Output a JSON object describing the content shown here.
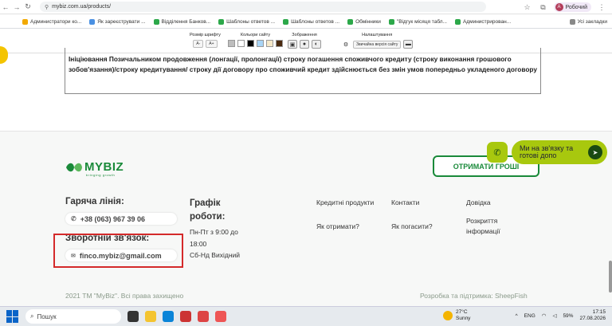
{
  "browser": {
    "url": "mybiz.com.ua/products/",
    "profile_label": "Робочий",
    "profile_initial": "А",
    "bookmarks": [
      "Администратори ко...",
      "Як зареєструвати ...",
      "Відділення Банков...",
      "Шаблоны ответов ...",
      "Шаблоны ответов ...",
      "Обмінники",
      "\"Відгук місяця табл...",
      "Администрирован..."
    ],
    "all_bookmarks": "Усі закладки"
  },
  "a11y": {
    "font_size_title": "Розмір шрифту",
    "font_minus": "A-",
    "font_plus": "A+",
    "colors_title": "Кольори сайту",
    "colors": [
      "#bdbdbd",
      "#ffffff",
      "#000000",
      "#a8d4f5",
      "#f5e8c8",
      "#4a2a10"
    ],
    "images_title": "Зображення",
    "settings_title": "Налаштування",
    "normal_version": "Звичайна версія сайту"
  },
  "content": {
    "text": "Ініціювання Позичальником продовження (лонгації, пролонгації) строку погашення споживчого кредиту (строку виконання грошового зобов'язання)/строку кредитування/ строку дії договору про споживчий кредит здійснюється без змін умов попередньо укладеного договору"
  },
  "footer": {
    "logo_text": "MYBIZ",
    "logo_tagline": "bringing growth",
    "get_money": "ОТРИМАТИ ГРОШІ",
    "hotline_title": "Гаряча лінія:",
    "phone": "+38 (063) 967 39 06",
    "feedback_title": "Зворотній зв'язок:",
    "email": "finco.mybiz@gmail.com",
    "schedule_title": "Графік роботи:",
    "schedule_lines": [
      "Пн-Пт з 9:00 до",
      "18:00",
      "Сб-Нд Вихідний"
    ],
    "links": {
      "credit_products": "Кредитні продукти",
      "contacts": "Контакти",
      "help": "Довідка",
      "how_get": "Як отримати?",
      "how_repay": "Як погасити?",
      "disclosure": "Розкриття інформації"
    },
    "copyright": "2021 ТМ \"MyBiz\". Всі права захищено",
    "developer": "Розробка та підтримка: SheepFish",
    "chat_text": "Ми на зв'язку та готові допо"
  },
  "taskbar": {
    "search_placeholder": "Пошук",
    "temperature": "27°C",
    "weather": "Sunny",
    "language": "ENG",
    "battery": "59%",
    "time": "17:15",
    "date": "27.08.2026"
  }
}
